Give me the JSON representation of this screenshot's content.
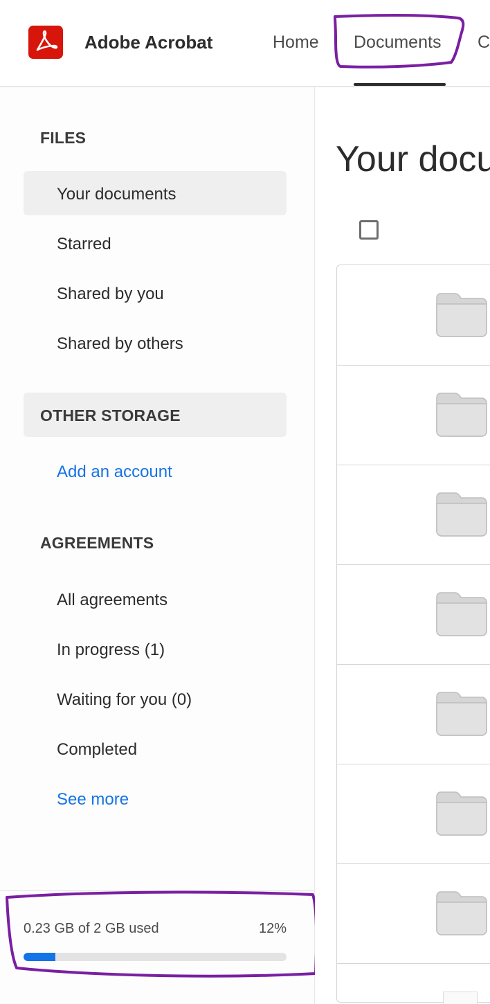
{
  "header": {
    "app_title": "Adobe Acrobat",
    "nav": [
      {
        "label": "Home"
      },
      {
        "label": "Documents",
        "active": true
      },
      {
        "label": "C"
      }
    ]
  },
  "sidebar": {
    "files": {
      "heading": "FILES",
      "items": [
        {
          "label": "Your documents",
          "selected": true
        },
        {
          "label": "Starred"
        },
        {
          "label": "Shared by you"
        },
        {
          "label": "Shared by others"
        }
      ]
    },
    "other_storage": {
      "heading": "OTHER STORAGE",
      "add_account": "Add an account"
    },
    "agreements": {
      "heading": "AGREEMENTS",
      "items": [
        {
          "label": "All agreements"
        },
        {
          "label": "In progress (1)"
        },
        {
          "label": "Waiting for you (0)"
        },
        {
          "label": "Completed"
        }
      ],
      "see_more": "See more"
    },
    "storage": {
      "used_text": "0.23 GB of 2 GB used",
      "percent_text": "12%",
      "percent": 12
    }
  },
  "main": {
    "title": "Your docu",
    "rows": [
      {
        "type": "folder"
      },
      {
        "type": "folder"
      },
      {
        "type": "folder"
      },
      {
        "type": "folder"
      },
      {
        "type": "folder"
      },
      {
        "type": "folder"
      },
      {
        "type": "folder"
      }
    ]
  },
  "colors": {
    "brand_red": "#d7150b",
    "accent_blue": "#1473e6",
    "annotation_purple": "#7a1fa2",
    "selected_bg": "#efefef"
  }
}
